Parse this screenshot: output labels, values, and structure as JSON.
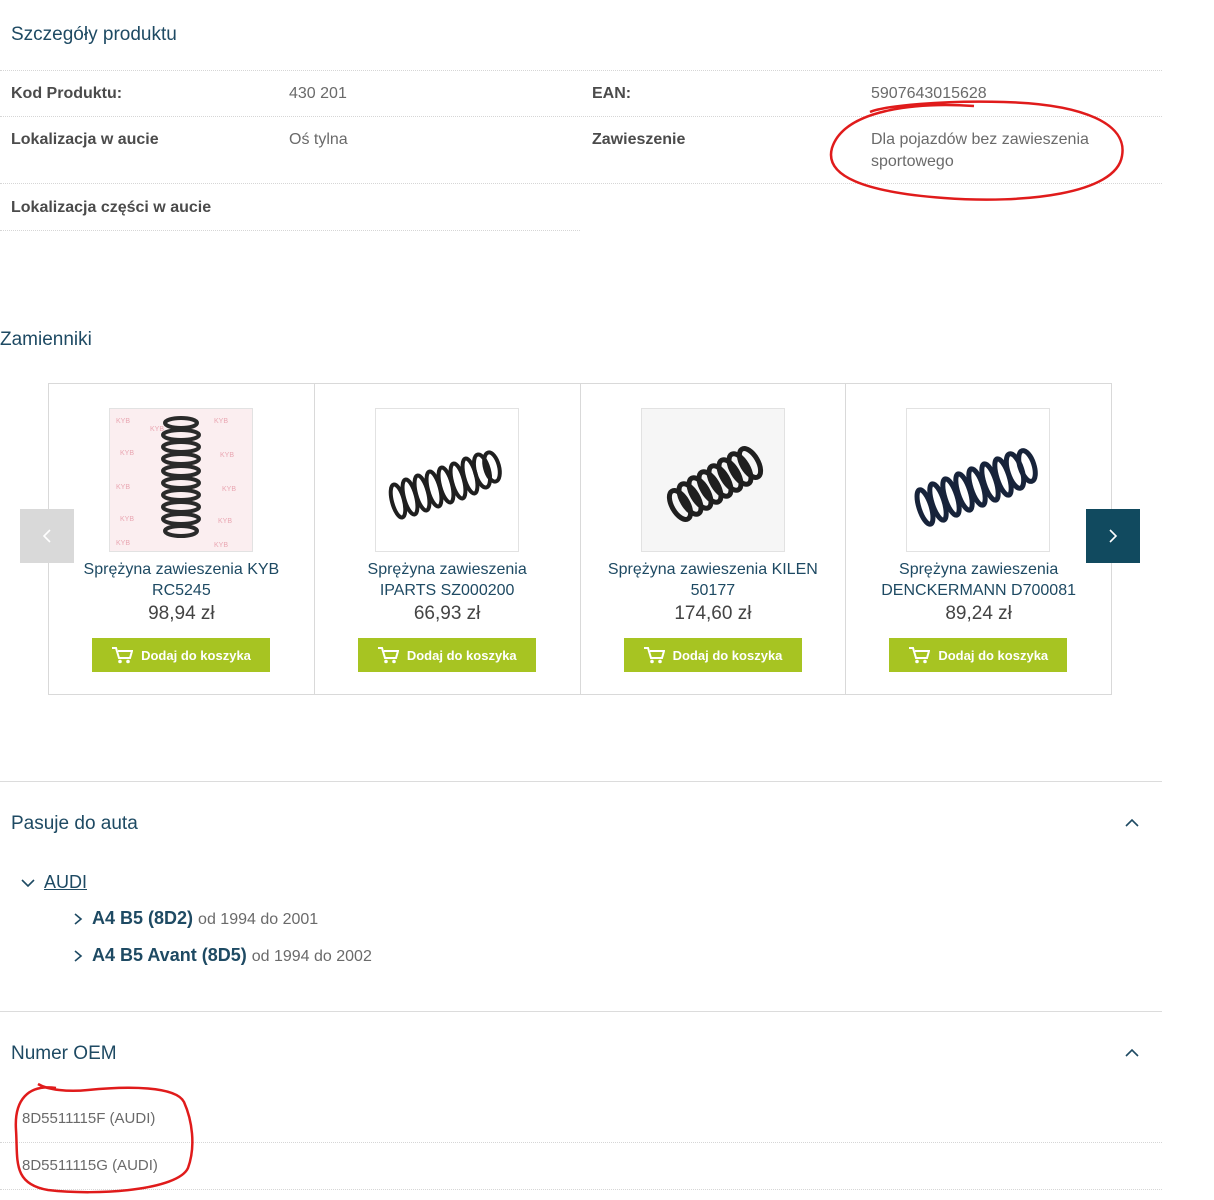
{
  "details": {
    "title": "Szczegóły produktu",
    "rows": [
      {
        "label": "Kod Produktu:",
        "value": "430 201"
      },
      {
        "label": "EAN:",
        "value": "5907643015628"
      },
      {
        "label": "Lokalizacja w aucie",
        "value": "Oś tylna"
      },
      {
        "label": "Zawieszenie",
        "value": "Dla pojazdów bez zawieszenia sportowego"
      },
      {
        "label": "Lokalizacja części w aucie",
        "value": ""
      }
    ]
  },
  "replacements": {
    "title": "Zamienniki",
    "products": [
      {
        "name_line1": "Sprężyna zawieszenia KYB",
        "name_line2": "RC5245",
        "price": "98,94 zł",
        "button": "Dodaj do koszyka"
      },
      {
        "name_line1": "Sprężyna zawieszenia",
        "name_line2": "IPARTS SZ000200",
        "price": "66,93 zł",
        "button": "Dodaj do koszyka"
      },
      {
        "name_line1": "Sprężyna zawieszenia KILEN",
        "name_line2": "50177",
        "price": "174,60 zł",
        "button": "Dodaj do koszyka"
      },
      {
        "name_line1": "Sprężyna zawieszenia",
        "name_line2": "DENCKERMANN D700081",
        "price": "89,24 zł",
        "button": "Dodaj do koszyka"
      }
    ]
  },
  "fits": {
    "title": "Pasuje do auta",
    "brand": "AUDI",
    "models": [
      {
        "name": "A4 B5 (8D2)",
        "years": "od 1994 do 2001"
      },
      {
        "name": "A4 B5 Avant (8D5)",
        "years": "od 1994 do 2002"
      }
    ]
  },
  "oem": {
    "title": "Numer OEM",
    "numbers": [
      "8D5511115F (AUDI)",
      "8D5511115G (AUDI)"
    ]
  },
  "colors": {
    "heading": "#1e4a63",
    "button": "#a7c422",
    "next_arrow_bg": "#114a5f",
    "prev_arrow_bg": "#d9d9d9",
    "annotation": "#e01b1b"
  }
}
